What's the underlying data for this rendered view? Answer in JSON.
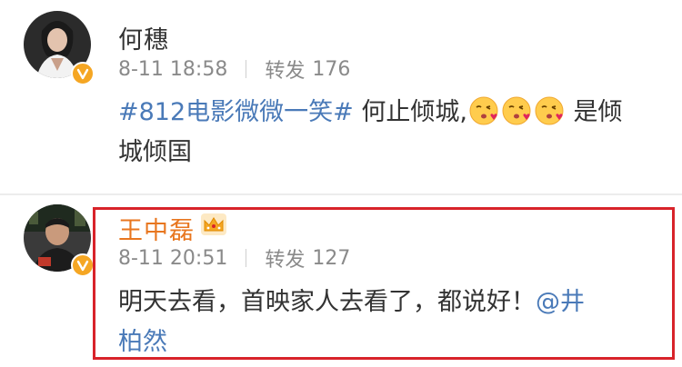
{
  "posts": [
    {
      "author": "何穗",
      "time": "8-11 18:58",
      "repost_label": "转发",
      "repost_count": "176",
      "topic": "#812电影微微一笑#",
      "text_before_emoji": " 何止倾城,",
      "text_after_emoji_line1": " 是倾",
      "text_line2": "城倾国",
      "emoji_icon": "kiss-emoji-icon",
      "verified_color": "#f5a623"
    },
    {
      "author": "王中磊",
      "time": "8-11 20:51",
      "repost_label": "转发",
      "repost_count": "127",
      "text_line1": "明天去看，首映家人去看了，都说好！",
      "mention_part1": "@井",
      "mention_part2": "柏然",
      "author_color": "#e8761f",
      "crown_icon": "crown-icon",
      "highlight_color": "#d8232a"
    }
  ],
  "colors": {
    "link": "#4a7ab8",
    "meta": "#8a8a8a",
    "text": "#333333"
  }
}
